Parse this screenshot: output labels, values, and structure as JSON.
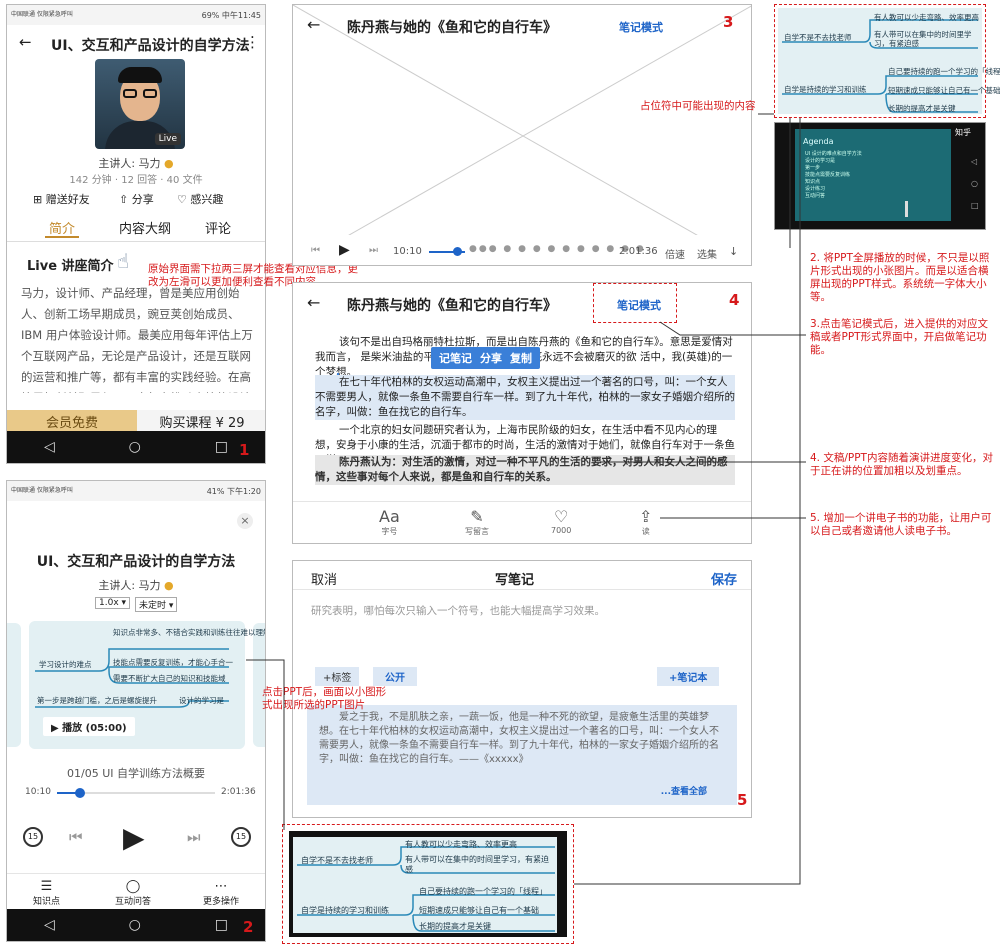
{
  "phone1": {
    "status": {
      "carrier": "中国联通 仅限紧急呼叫",
      "right": "69% 中午11:45"
    },
    "title": "UI、交互和产品设计的自学方法",
    "speaker": "主讲人: 马力",
    "stats": "142 分钟 · 12 回答 · 40 文件",
    "live_badge": "Live",
    "actions": [
      "赠送好友",
      "分享",
      "感兴趣"
    ],
    "tabs": [
      "简介",
      "内容大纲",
      "评论"
    ],
    "section_title": "Live 讲座简介",
    "desc": "马力，设计师、产品经理，曾是美应用创始人、创新工场早期成员，豌豆荚创始成员、IBM 用户体验设计师。最美应用每年评估上万个互联网产品，无论是产品设计，还是互联网的运营和推广等，都有丰富的实践经验。在高校里担任兼职导师，一直努力推动高校的设计专业领域教学。在",
    "btn_left": "会员免费",
    "btn_right": "购买课程 ¥ 29",
    "num": "1"
  },
  "phone2": {
    "status": {
      "carrier": "中国联通 仅限紧急呼叫",
      "right": "41% 下午1:20"
    },
    "close": "×",
    "title": "UI、交互和产品设计的自学方法",
    "speaker": "主讲人: 马力",
    "speed": "1.0x ▾",
    "timer": "未定时 ▾",
    "card_nodes": [
      "知识点非常多、不错合实践和训练往往难以理解",
      "学习设计的难点",
      "技能点需要反复训练，才能心手合一",
      "需要不断扩大自己的知识和技能域",
      "第一步是跨越门槛，之后是螺旋提升",
      "设计的学习是"
    ],
    "play_label": "▶ 播放 (05:00)",
    "track": "01/05  UI 自学训练方法概要",
    "time_start": "10:10",
    "time_end": "2:01:36",
    "skip": "15",
    "bottom": [
      "知识点",
      "互动问答",
      "更多操作"
    ],
    "num": "2"
  },
  "wf3": {
    "back": "←",
    "title": "陈丹燕与她的《鱼和它的自行车》",
    "mode": "笔记模式",
    "num": "3",
    "time_start": "10:10",
    "time_end": "2:01:36",
    "speed": "倍速",
    "select": "选集"
  },
  "wf4": {
    "back": "←",
    "title": "陈丹燕与她的《鱼和它的自行车》",
    "mode": "笔记模式",
    "num": "4",
    "menu": [
      "记笔记",
      "分享",
      "复制"
    ],
    "para1": "该句不是出自玛格丽特杜拉斯，而是出自陈丹燕的《鱼和它的自行车》。意思是爱情对我而言，不是肌肤之亲，不是一蔬一饭，它是一种不死的欲望，是疲惫生活中的英雄梦想。",
    "para1_display": "该句不是出自玛格丽特杜拉斯，而是出自陈丹燕的《鱼和它的自行车》。意思是爱情对我而言，                    是柴米油盐的平淡生活,而是一种在心底永远不会被磨灭的欲                    活中，我(英雄)的一个梦想。",
    "para2": "在七十年代柏林的女权运动高潮中，女权主义提出过一个著名的口号，叫：一个女人不需要男人，就像一条鱼不需要自行车一样。到了九十年代，柏林的一家女子婚姻介绍所的名字，叫做：鱼在找它的自行车。",
    "para3": "一个北京的妇女问题研究者认为，上海市民阶级的妇女，在生活中看不见内心的理想，安身于小康的生活，沉湎于都市的时尚，生活的激情对于她们，就像自行车对于一条鱼一样。",
    "para4": "陈丹燕认为：对生活的激情，对过一种不平凡的生活的要求，对男人和女人之间的感情，这些事对每个人来说，都是鱼和自行车的关系。",
    "toolbar": [
      {
        "icon": "Aa",
        "label": "字号"
      },
      {
        "icon": "✎",
        "label": "写留言"
      },
      {
        "icon": "♡",
        "label": "7000"
      },
      {
        "icon": "⇪",
        "label": "读"
      }
    ]
  },
  "wf5": {
    "cancel": "取消",
    "title": "写笔记",
    "save": "保存",
    "placeholder": "研究表明，哪怕每次只输入一个符号，也能大幅提高学习效果。",
    "tag": "+标签",
    "public": "公开",
    "notebook": "+笔记本",
    "quote": "爱之于我，不是肌肤之亲，一蔬一饭，他是一种不死的欲望，是疲惫生活里的英雄梦想。在七十年代柏林的女权运动高潮中，女权主义提出过一个著名的口号，叫：一个女人不需要男人，就像一条鱼不需要自行车一样。到了九十年代，柏林的一家女子婚姻介绍所的名字，叫做：鱼在找它的自行车。——《xxxxx》",
    "view_all": "...查看全部",
    "num": "5"
  },
  "mindmap": {
    "left1": "自学不是不去找老师",
    "left2": "自学是持续的学习和训练",
    "r1": "有人教可以少走弯路、效率更高",
    "r2": "有人带可以在集中的时间里学习，有紧迫感",
    "r3": "自己要持续的跑一个学习的「线程」",
    "r4": "短期速成只能够让自己有一个基础",
    "r5": "长期的提高才是关键"
  },
  "ppt": {
    "brand": "知乎",
    "slide_title": "Agenda",
    "lines": [
      "UI 设计的难点和自学方法",
      "设计的学习是",
      "第一步",
      "技能点需要反复训练",
      "知识点",
      "设计练习",
      "互动问答"
    ]
  },
  "annotations": {
    "a1": "原始界面需下拉两三屏才能查看对应信息，更改为左滑可以更加便利查看不同内容。",
    "a_placeholder": "占位符中可能出现的内容",
    "a2": "2. 将PPT全屏播放的时候，不只是以照片形式出现的小张图片。而是以适合横屏出现的PPT样式。系统统一字体大小等。",
    "a3": "3.点击笔记模式后，进入提供的对应文稿或者PPT形式界面中，开启做笔记功能。",
    "a4": "4. 文稿/PPT内容随着演讲进度变化，对于正在讲的位置加粗以及划重点。",
    "a5": "5. 增加一个讲电子书的功能，让用户可以自己或者邀请他人读电子书。",
    "a_ppt": "点击PPT后，画面以小图形式出现所选的PPT图片"
  }
}
